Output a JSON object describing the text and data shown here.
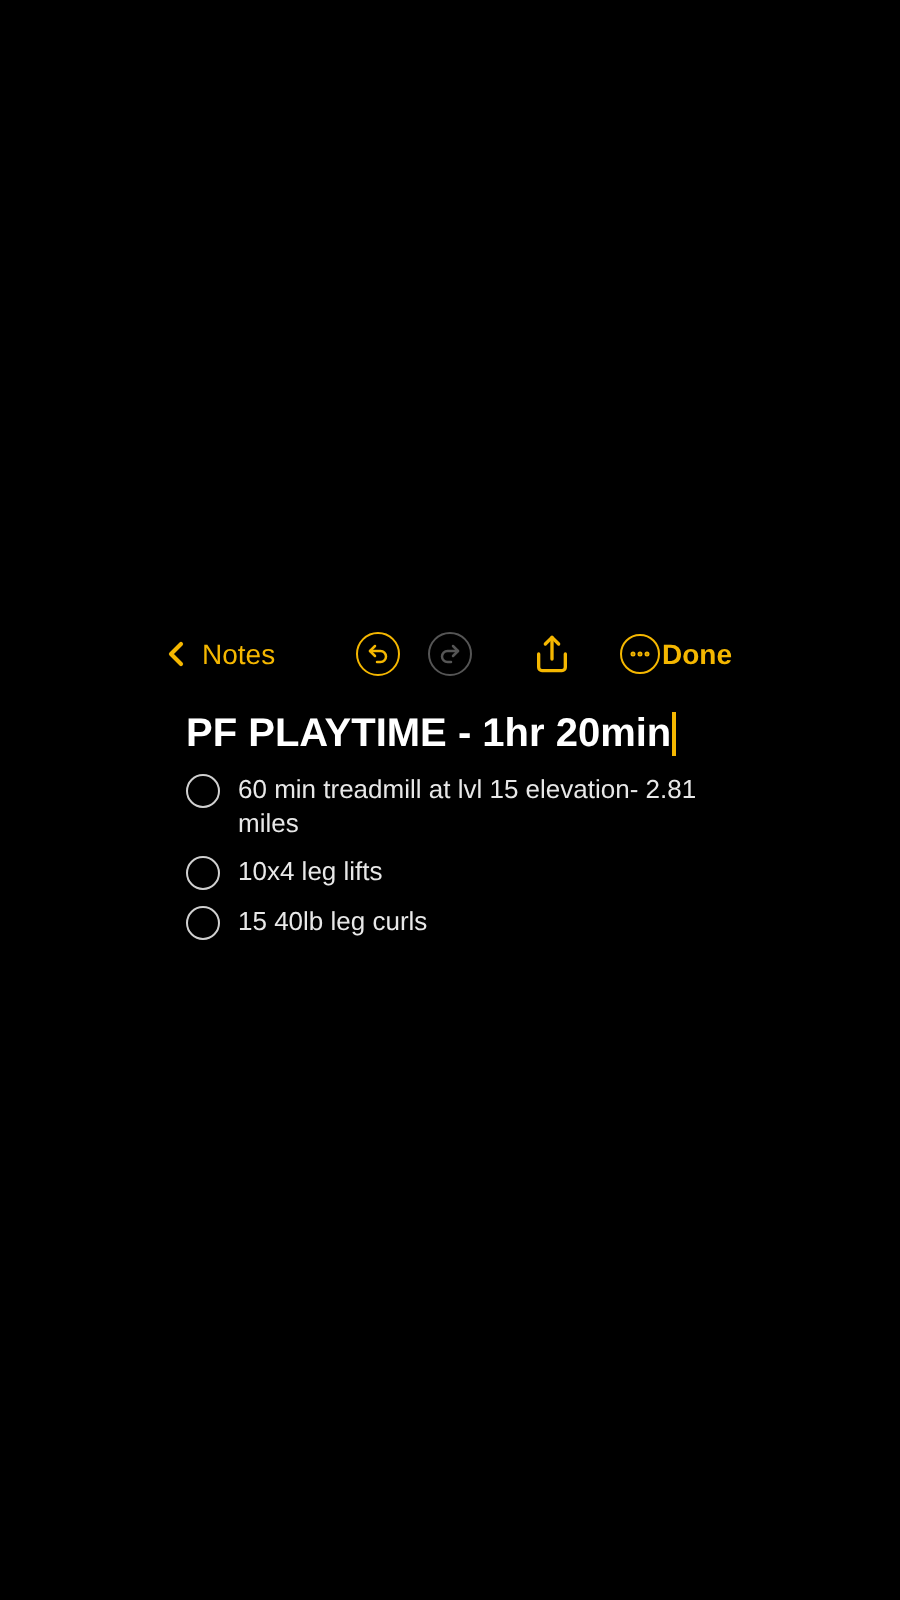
{
  "toolbar": {
    "back_label": "Notes",
    "undo": {
      "disabled": false
    },
    "redo": {
      "disabled": true
    },
    "done_label": "Done"
  },
  "note": {
    "title": "PF PLAYTIME - 1hr 20min",
    "checklist": [
      {
        "text": "60 min treadmill at lvl 15 elevation- 2.81 miles",
        "checked": false
      },
      {
        "text": "10x4 leg lifts",
        "checked": false
      },
      {
        "text": "15 40lb leg curls",
        "checked": false
      }
    ]
  }
}
